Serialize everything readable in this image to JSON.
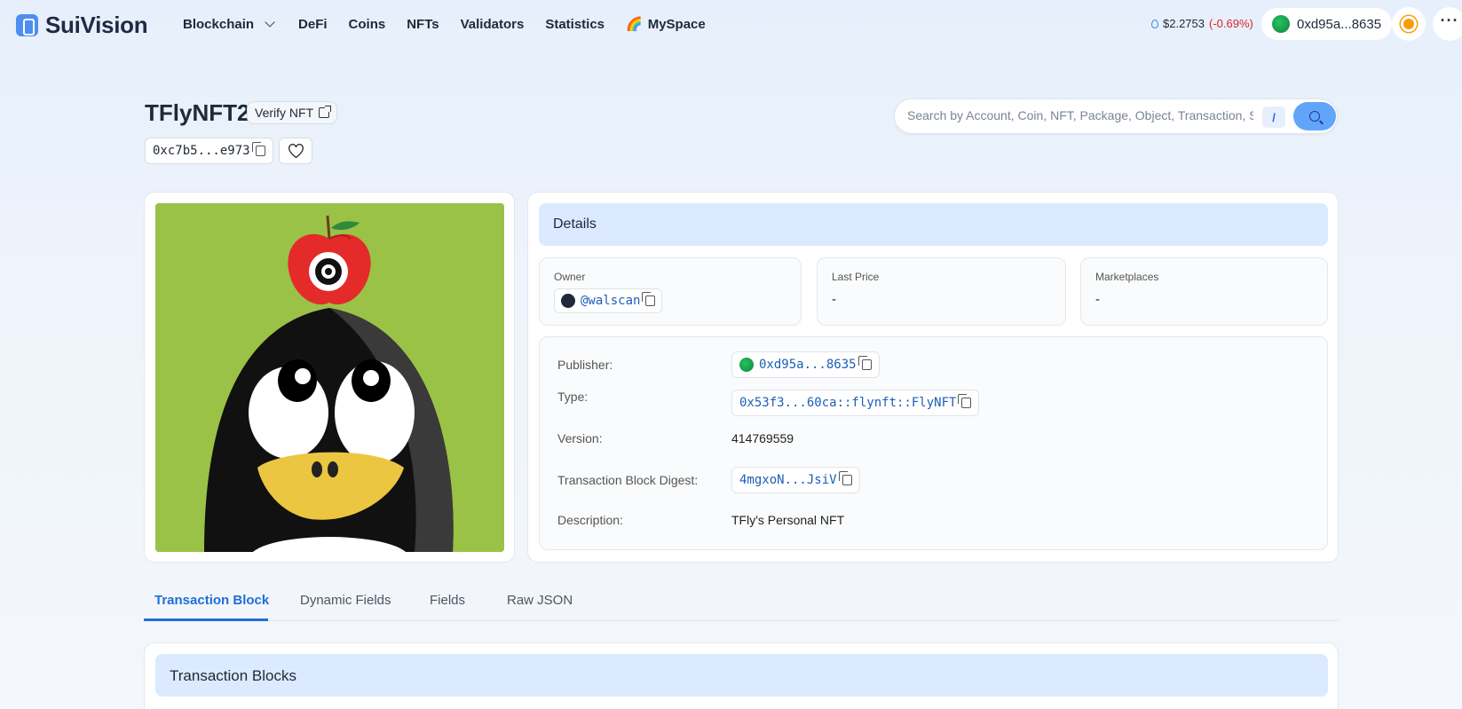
{
  "nav": {
    "logo": "SuiVision",
    "menu": [
      "Blockchain",
      "DeFi",
      "Coins",
      "NFTs",
      "Validators",
      "Statistics"
    ],
    "myspace": "MySpace",
    "price": "$2.2753",
    "price_change": "(-0.69%)",
    "wallet": "0xd95a...8635",
    "accent": "#1d6fd8"
  },
  "header": {
    "title": "TFlyNFT2",
    "verify_label": "Verify NFT",
    "address": "0xc7b5...e973",
    "search_placeholder": "Search by Account, Coin, NFT, Package, Object, Transaction, S...",
    "search_shortcut": "/"
  },
  "details": {
    "heading": "Details",
    "owner_label": "Owner",
    "owner_value": "@walscan",
    "last_price_label": "Last Price",
    "last_price_value": "-",
    "marketplaces_label": "Marketplaces",
    "marketplaces_value": "-",
    "rows": [
      {
        "label": "Publisher:",
        "value": "0xd95a...8635"
      },
      {
        "label": "Type:",
        "value": "0x53f3...60ca::flynft::FlyNFT"
      },
      {
        "label": "Version:",
        "value": "414769559"
      },
      {
        "label": "Transaction Block Digest:",
        "value": "4mgxoN...JsiV"
      },
      {
        "label": "Description:",
        "value": "TFly's Personal NFT"
      }
    ]
  },
  "tabs": [
    "Transaction Block",
    "Dynamic Fields",
    "Fields",
    "Raw JSON"
  ],
  "transaction_blocks": {
    "heading": "Transaction Blocks"
  }
}
